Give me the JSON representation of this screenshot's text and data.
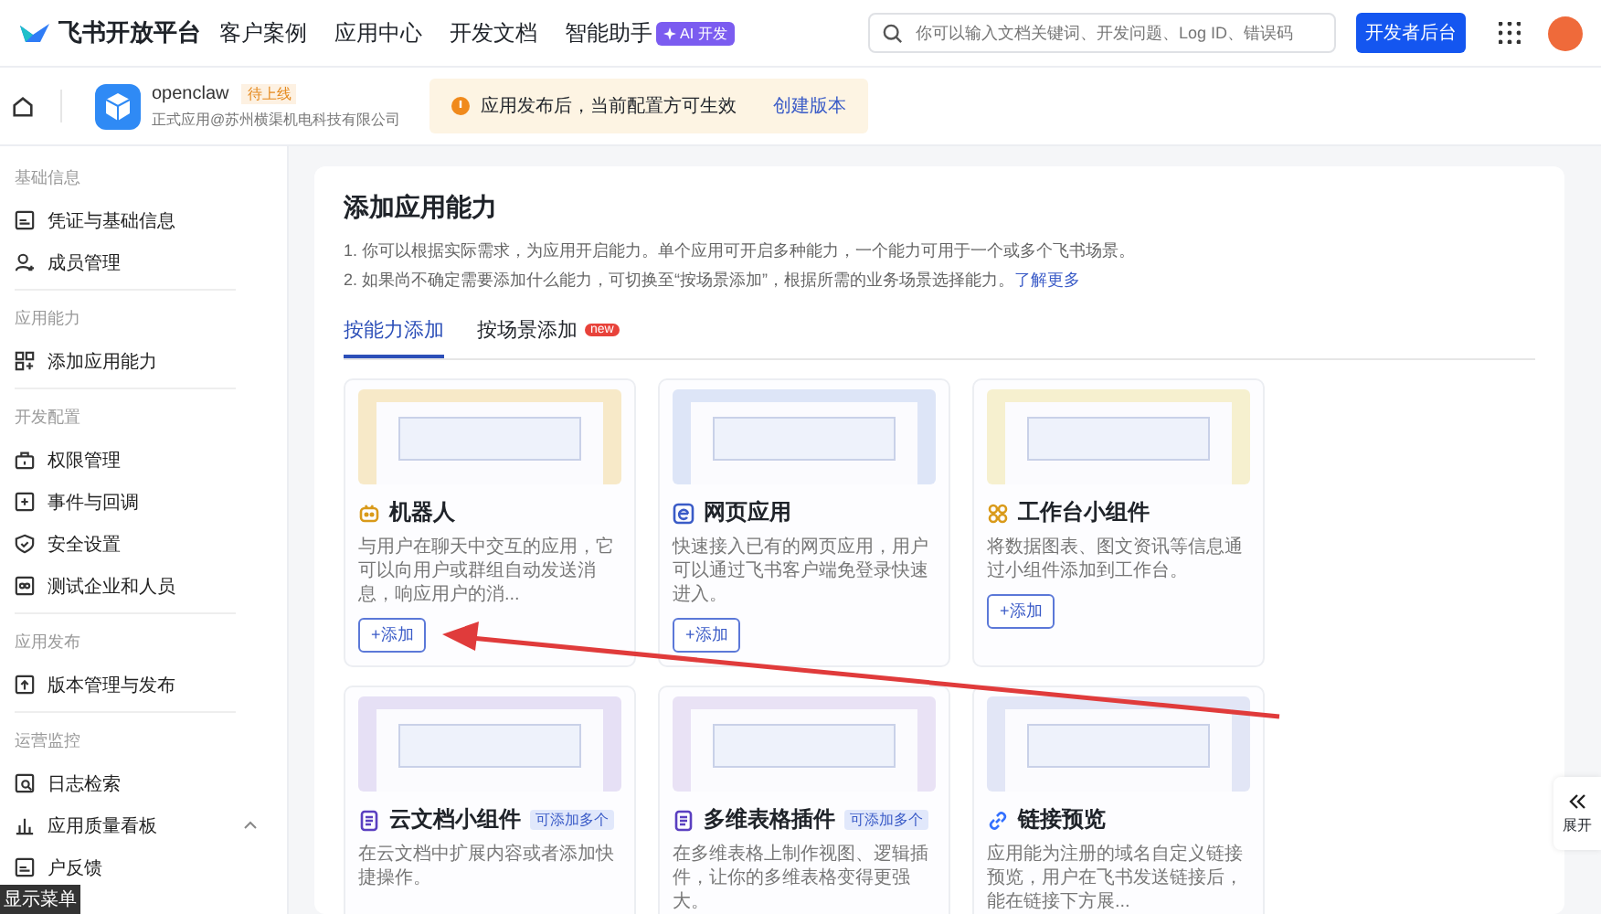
{
  "topbar": {
    "brand": "飞书开放平台",
    "nav": [
      {
        "label": "客户案例"
      },
      {
        "label": "应用中心"
      },
      {
        "label": "开发文档"
      },
      {
        "label": "智能助手",
        "badge": "AI 开发"
      }
    ],
    "search": {
      "placeholder": "你可以输入文档关键词、开发问题、Log ID、错误码"
    },
    "console_button": "开发者后台"
  },
  "app_bar": {
    "app_name": "openclaw",
    "status_badge": "待上线",
    "subtitle": "正式应用@苏州横渠机电科技有限公司",
    "notice": {
      "text": "应用发布后，当前配置方可生效",
      "link": "创建版本"
    }
  },
  "sidebar": {
    "groups": [
      {
        "title": "基础信息",
        "items": [
          {
            "label": "凭证与基础信息"
          },
          {
            "label": "成员管理"
          }
        ]
      },
      {
        "title": "应用能力",
        "items": [
          {
            "label": "添加应用能力"
          }
        ]
      },
      {
        "title": "开发配置",
        "items": [
          {
            "label": "权限管理"
          },
          {
            "label": "事件与回调"
          },
          {
            "label": "安全设置"
          },
          {
            "label": "测试企业和人员"
          }
        ]
      },
      {
        "title": "应用发布",
        "items": [
          {
            "label": "版本管理与发布"
          }
        ]
      },
      {
        "title": "运营监控",
        "items": [
          {
            "label": "日志检索"
          },
          {
            "label": "应用质量看板",
            "expanded": true
          },
          {
            "label": "户反馈"
          }
        ]
      }
    ],
    "tooltip": "显示菜单"
  },
  "content": {
    "title": "添加应用能力",
    "notes": [
      {
        "text": "1. 你可以根据实际需求，为应用开启能力。单个应用可开启多种能力，一个能力可用于一个或多个飞书场景。"
      },
      {
        "text": "2. 如果尚不确定需要添加什么能力，可切换至“按场景添加”，根据所需的业务场景选择能力。",
        "link": "了解更多"
      }
    ],
    "tabs": [
      {
        "label": "按能力添加",
        "selected": true
      },
      {
        "label": "按场景添加",
        "badge": "new",
        "selected": false
      }
    ],
    "cards": [
      {
        "title": "机器人",
        "color": "#f7e9c8",
        "description": "与用户在聊天中交互的应用，它可以向用户或群组自动发送消息，响应用户的消...",
        "button": "+添加"
      },
      {
        "title": "网页应用",
        "color": "#dde5f7",
        "description": "快速接入已有的网页应用，用户可以通过飞书客户端免登录快速进入。",
        "button": "+添加"
      },
      {
        "title": "工作台小组件",
        "color": "#f6f0cf",
        "description": "将数据图表、图文资讯等信息通过小组件添加到工作台。",
        "button": "+添加"
      },
      {
        "title": "云文档小组件",
        "tag": "可添加多个",
        "color": "#e6e0f5",
        "description": "在云文档中扩展内容或者添加快捷操作。"
      },
      {
        "title": "多维表格插件",
        "tag": "可添加多个",
        "color": "#e9e2f5",
        "description": "在多维表格上制作视图、逻辑插件，让你的多维表格变得更强大。"
      },
      {
        "title": "链接预览",
        "color": "#e2e6f6",
        "description": "应用能为注册的域名自定义链接预览，用户在飞书发送链接后，能在链接下方展..."
      }
    ]
  },
  "expand_button": "展开"
}
